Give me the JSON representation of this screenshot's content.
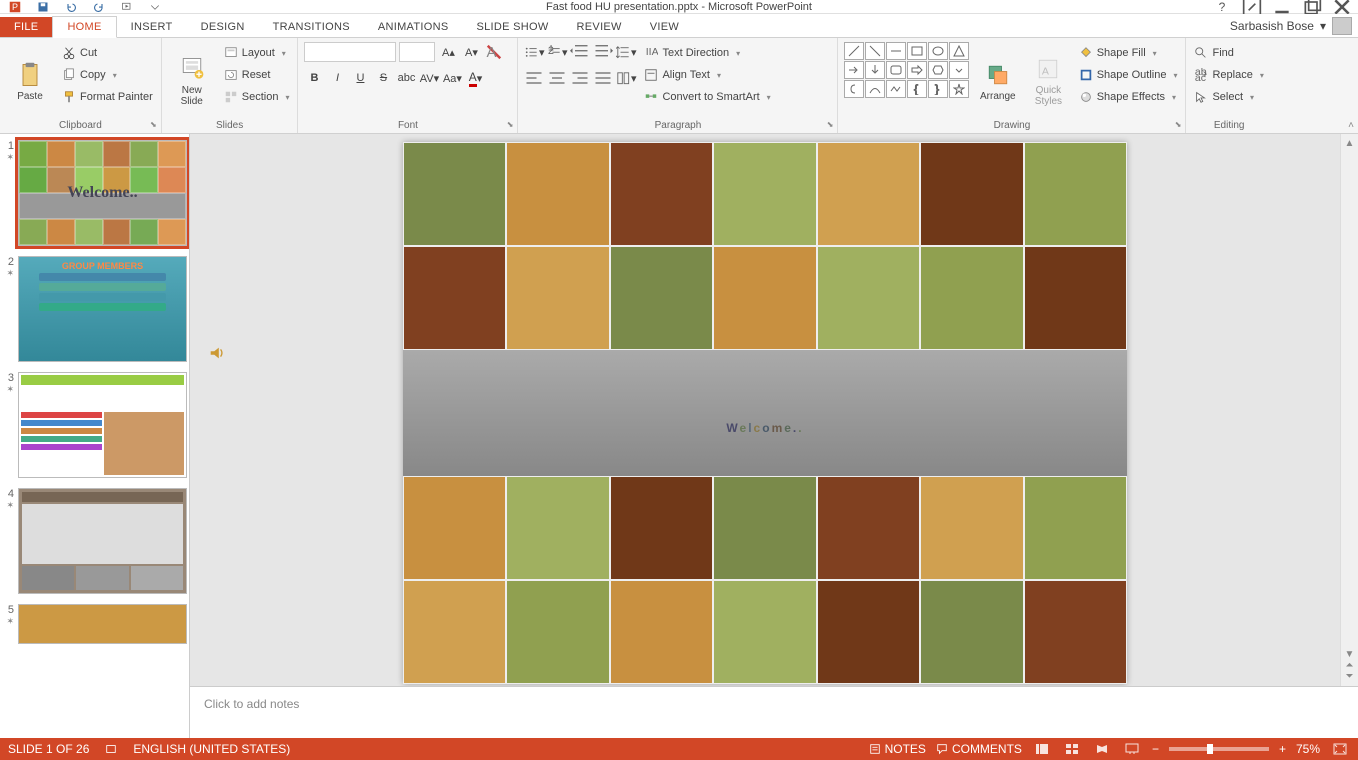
{
  "app": {
    "title": "Fast food HU presentation.pptx - Microsoft PowerPoint",
    "account_name": "Sarbasish Bose"
  },
  "tabs": {
    "file": "FILE",
    "items": [
      "HOME",
      "INSERT",
      "DESIGN",
      "TRANSITIONS",
      "ANIMATIONS",
      "SLIDE SHOW",
      "REVIEW",
      "VIEW"
    ],
    "active_index": 0
  },
  "ribbon": {
    "clipboard": {
      "label": "Clipboard",
      "paste": "Paste",
      "cut": "Cut",
      "copy": "Copy",
      "format_painter": "Format Painter"
    },
    "slides": {
      "label": "Slides",
      "new_slide": "New\nSlide",
      "layout": "Layout",
      "reset": "Reset",
      "section": "Section"
    },
    "font": {
      "label": "Font"
    },
    "paragraph": {
      "label": "Paragraph",
      "text_direction": "Text Direction",
      "align_text": "Align Text",
      "convert_smartart": "Convert to SmartArt"
    },
    "drawing": {
      "label": "Drawing",
      "arrange": "Arrange",
      "quick_styles": "Quick\nStyles",
      "shape_fill": "Shape Fill",
      "shape_outline": "Shape Outline",
      "shape_effects": "Shape Effects"
    },
    "editing": {
      "label": "Editing",
      "find": "Find",
      "replace": "Replace",
      "select": "Select"
    }
  },
  "thumbnails": {
    "count": 5,
    "selected": 1,
    "slide2_title": "GROUP MEMBERS"
  },
  "slide": {
    "welcome": "Welcome.."
  },
  "notes": {
    "placeholder": "Click to add notes"
  },
  "status": {
    "slide_info": "SLIDE 1 OF 26",
    "language": "ENGLISH (UNITED STATES)",
    "notes": "NOTES",
    "comments": "COMMENTS",
    "zoom": "75%"
  }
}
